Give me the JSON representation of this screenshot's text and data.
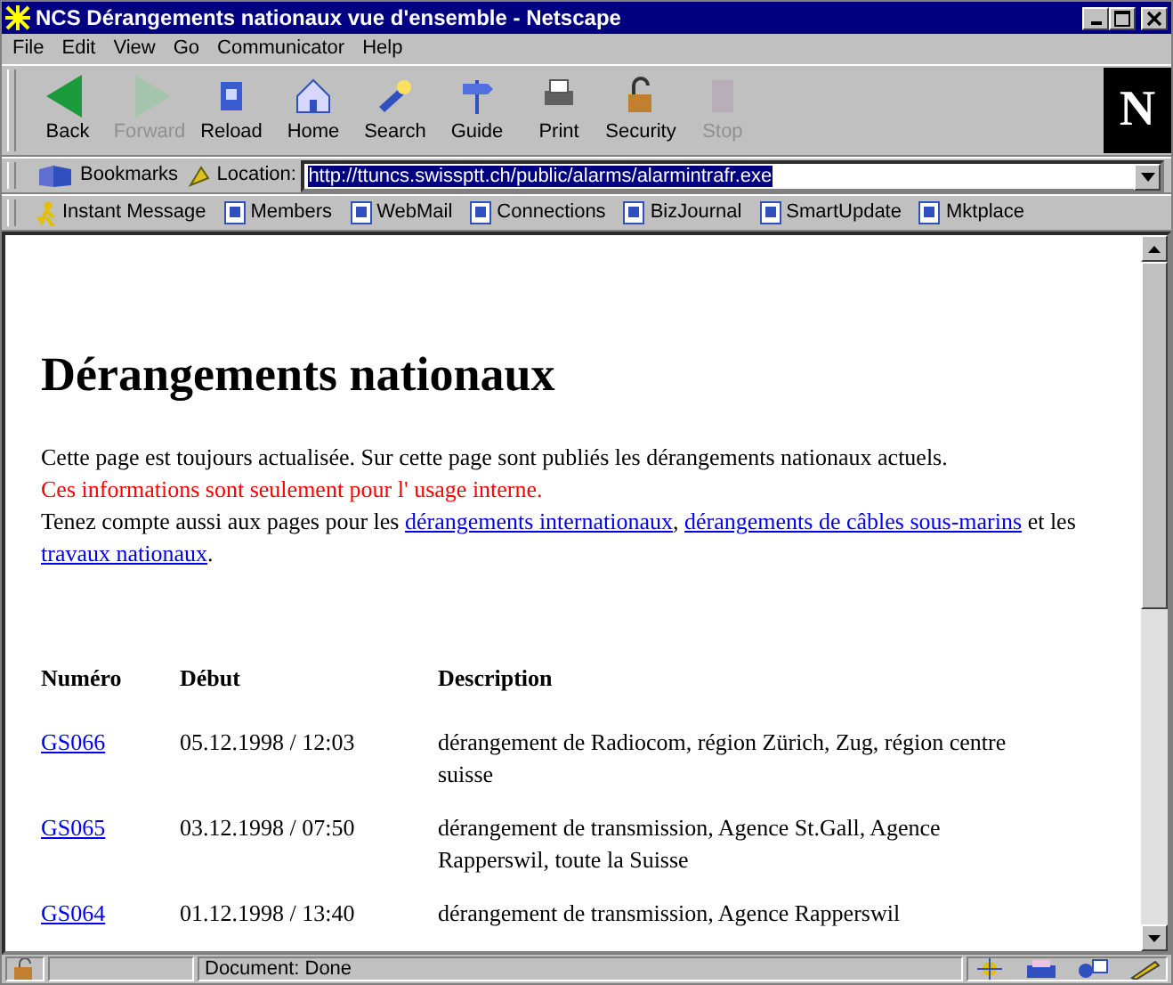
{
  "window": {
    "title": "NCS Dérangements nationaux vue d'ensemble - Netscape"
  },
  "menu": [
    "File",
    "Edit",
    "View",
    "Go",
    "Communicator",
    "Help"
  ],
  "toolbar": [
    {
      "label": "Back",
      "disabled": false,
      "kind": "back"
    },
    {
      "label": "Forward",
      "disabled": true,
      "kind": "forward"
    },
    {
      "label": "Reload",
      "disabled": false,
      "kind": "reload"
    },
    {
      "label": "Home",
      "disabled": false,
      "kind": "home"
    },
    {
      "label": "Search",
      "disabled": false,
      "kind": "search"
    },
    {
      "label": "Guide",
      "disabled": false,
      "kind": "guide"
    },
    {
      "label": "Print",
      "disabled": false,
      "kind": "print"
    },
    {
      "label": "Security",
      "disabled": false,
      "kind": "security"
    },
    {
      "label": "Stop",
      "disabled": true,
      "kind": "stop"
    }
  ],
  "logo": "N",
  "bookmarks": "Bookmarks",
  "location": {
    "label": "Location:",
    "value": "http://ttuncs.swissptt.ch/public/alarms/alarmintrafr.exe"
  },
  "personal_toolbar": [
    {
      "label": "Instant Message",
      "kind": "person"
    },
    {
      "label": "Members",
      "kind": "page"
    },
    {
      "label": "WebMail",
      "kind": "page"
    },
    {
      "label": "Connections",
      "kind": "page"
    },
    {
      "label": "BizJournal",
      "kind": "page"
    },
    {
      "label": "SmartUpdate",
      "kind": "page"
    },
    {
      "label": "Mktplace",
      "kind": "page"
    }
  ],
  "page": {
    "heading": "Dérangements nationaux",
    "paragraphs": [
      [
        {
          "text": "Cette page est toujours actualisée. Sur cette page sont publiés les dérangements nationaux actuels."
        }
      ],
      [
        {
          "text": "Ces informations sont seulement pour l' usage interne.",
          "kind": "warning"
        }
      ],
      [
        {
          "text": "Tenez compte aussi aux pages pour les "
        },
        {
          "text": "dérangements internationaux",
          "kind": "link"
        },
        {
          "text": ", "
        },
        {
          "text": "dérangements de câbles sous-marins",
          "kind": "link"
        },
        {
          "text": " et les "
        },
        {
          "text": "travaux nationaux",
          "kind": "link"
        },
        {
          "text": "."
        }
      ]
    ],
    "table": {
      "columns": [
        "Numéro",
        "Début",
        "Description"
      ],
      "rows": [
        {
          "numero": "GS066",
          "debut": "05.12.1998 / 12:03",
          "description": "dérangement de Radiocom, région Zürich, Zug, région centre suisse"
        },
        {
          "numero": "GS065",
          "debut": "03.12.1998 / 07:50",
          "description": "dérangement de transmission, Agence St.Gall, Agence Rapperswil, toute la Suisse"
        },
        {
          "numero": "GS064",
          "debut": "01.12.1998 / 13:40",
          "description": "dérangement de transmission, Agence Rapperswil"
        }
      ]
    }
  },
  "status_bar": {
    "text": "Document: Done"
  }
}
